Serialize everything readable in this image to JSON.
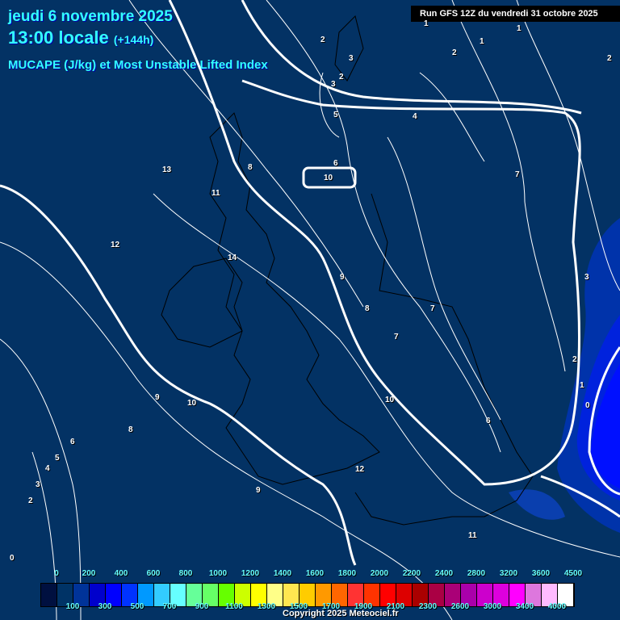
{
  "header": {
    "date": "jeudi 6 novembre 2025",
    "time": "13:00 locale",
    "lead": "(+144h)",
    "parameter": "MUCAPE (J/kg) et Most Unstable Lifted Index",
    "run": "Run GFS 12Z du vendredi 31 octobre 2025"
  },
  "contour_labels": [
    "2",
    "1",
    "1",
    "1",
    "2",
    "2",
    "3",
    "2",
    "3",
    "4",
    "5",
    "6",
    "10",
    "7",
    "8",
    "11",
    "13",
    "12",
    "14",
    "9",
    "8",
    "7",
    "7",
    "3",
    "2",
    "1",
    "0",
    "10",
    "9",
    "10",
    "8",
    "6",
    "6",
    "5",
    "4",
    "3",
    "2",
    "12",
    "9",
    "11",
    "0",
    "11"
  ],
  "legend": {
    "top_labels": [
      "0",
      "200",
      "400",
      "600",
      "800",
      "1000",
      "1200",
      "1400",
      "1600",
      "1800",
      "2000",
      "2200",
      "2400",
      "2800",
      "3200",
      "3600",
      "4500"
    ],
    "bottom_labels": [
      "100",
      "300",
      "500",
      "700",
      "900",
      "1100",
      "1300",
      "1500",
      "1700",
      "1900",
      "2100",
      "2300",
      "2600",
      "3000",
      "3400",
      "4000"
    ],
    "colors": [
      "#001040",
      "#003366",
      "#003399",
      "#0000cc",
      "#0000ff",
      "#0033ff",
      "#0099ff",
      "#33ccff",
      "#66ffff",
      "#66ff99",
      "#66ff66",
      "#66ff00",
      "#ccff00",
      "#ffff00",
      "#ffff88",
      "#ffe650",
      "#ffcc00",
      "#ff9900",
      "#ff6600",
      "#ff3333",
      "#ff3300",
      "#ff0000",
      "#dd0000",
      "#aa0000",
      "#aa0044",
      "#aa0077",
      "#aa00aa",
      "#cc00cc",
      "#dd00dd",
      "#ff00ff",
      "#dd77dd",
      "#ffbbff",
      "#ffffff"
    ]
  },
  "copyright": "Copyright 2025 Meteociel.fr"
}
